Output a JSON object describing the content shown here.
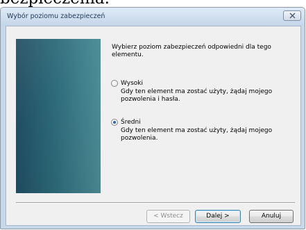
{
  "page": {
    "heading": "bezpieczenia."
  },
  "window": {
    "title": "Wybór poziomu zabezpieczeń"
  },
  "content": {
    "instruction": "Wybierz poziom zabezpieczeń odpowiedni dla tego elementu."
  },
  "options": [
    {
      "label": "Wysoki",
      "description": "Gdy ten element ma zostać użyty, żądaj mojego pozwolenia i hasła.",
      "selected": false
    },
    {
      "label": "Średni",
      "description": "Gdy ten element ma zostać użyty, żądaj mojego pozwolenia.",
      "selected": true
    }
  ],
  "buttons": {
    "back": "< Wstecz",
    "next": "Dalej >",
    "cancel": "Anuluj"
  },
  "icons": {
    "close": "close-icon"
  },
  "colors": {
    "side_panel": "#2d6a7a",
    "radio_selected": "#2b64b8"
  }
}
